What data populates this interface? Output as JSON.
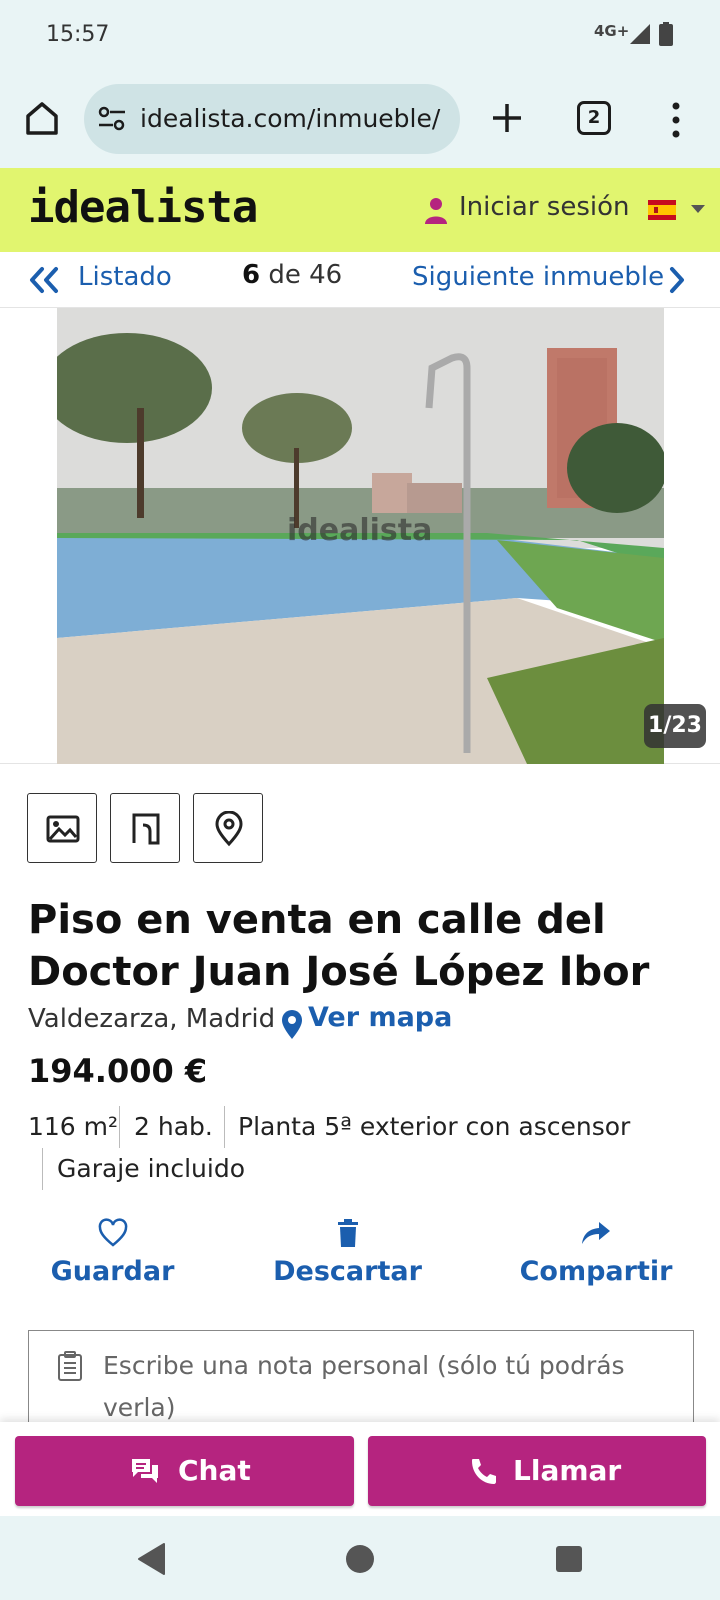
{
  "status_bar": {
    "time": "15:57",
    "network": "4G+",
    "icons": [
      "signal-icon",
      "battery-icon"
    ]
  },
  "browser": {
    "url": "idealista.com/inmueble/",
    "tab_count": "2",
    "icons": [
      "home-icon",
      "site-settings-icon",
      "new-tab-icon",
      "tabs-icon",
      "more-options-icon"
    ]
  },
  "header": {
    "logo": "idealista",
    "login_label": "Iniciar sesión",
    "language_flag": "spain-flag",
    "brand_color": "#e1f56f"
  },
  "nav": {
    "back_label": "Listado",
    "position_current": "6",
    "position_rest": " de 46",
    "next_label": "Siguiente inmueble"
  },
  "gallery": {
    "photo_counter": "1/23",
    "watermark": "idealista"
  },
  "media_buttons": [
    "photos-icon",
    "floorplan-icon",
    "map-pin-icon"
  ],
  "listing": {
    "title": "Piso en venta en calle del Doctor Juan José López Ibor",
    "location": "Valdezarza, Madrid",
    "map_link": "Ver mapa",
    "price": "194.000 €",
    "features": [
      "116 m²",
      "2 hab.",
      "Planta 5ª exterior con ascensor",
      "Garaje incluido"
    ]
  },
  "actions": {
    "save": "Guardar",
    "discard": "Descartar",
    "share": "Compartir"
  },
  "note": {
    "placeholder_line1": "Escribe una nota personal (sólo tú podrás",
    "placeholder_line2": "verla)"
  },
  "contact": {
    "chat": "Chat",
    "call": "Llamar",
    "button_color": "#b5247f"
  },
  "colors": {
    "link": "#1b5eae",
    "browser_chrome": "#e9f4f5"
  }
}
